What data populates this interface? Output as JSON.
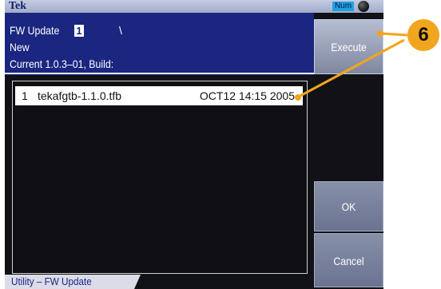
{
  "status_bar": {
    "brand": "Tek",
    "num_badge": "Num"
  },
  "header": {
    "line1": "FW Update",
    "char_input": "1",
    "path_separator": "\\",
    "line2": "New",
    "line3": "Current  1.0.3–01, Build:"
  },
  "file_list": {
    "items": [
      {
        "index": "1",
        "name": "tekafgtb-1.1.0.tfb",
        "date": "OCT12 14:15 2005"
      }
    ]
  },
  "menu_tab": {
    "label": "Utility – FW Update"
  },
  "softkeys": {
    "execute": "Execute",
    "ok": "OK",
    "cancel": "Cancel"
  },
  "callout": {
    "label": "6",
    "color": "#f2a51e"
  },
  "colors": {
    "header_bg": "#1a2680",
    "screen_bg": "#111216",
    "badge_blue": "#1fa1df",
    "softkey_gray": "#7f889f"
  }
}
